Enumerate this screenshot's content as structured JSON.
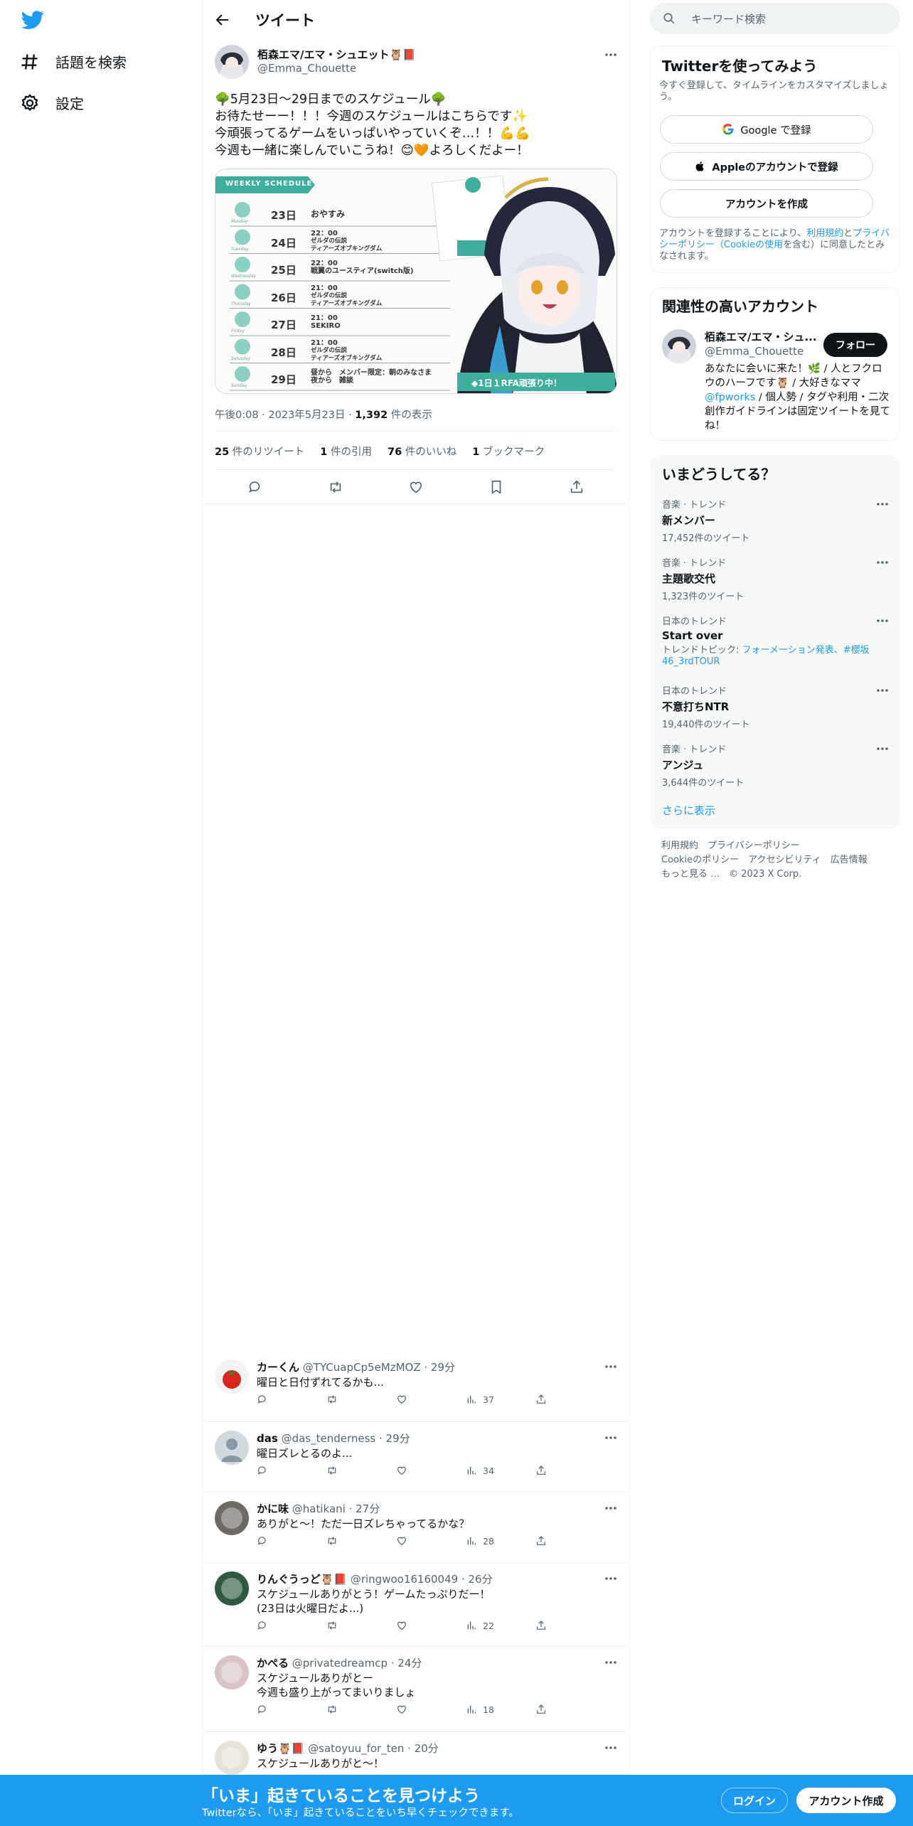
{
  "nav": {
    "explore": "話題を検索",
    "settings": "設定"
  },
  "header": {
    "title": "ツイート"
  },
  "tweet": {
    "name": "栢森エマ/エマ・シュエット🦉📕",
    "handle": "@Emma_Chouette",
    "text": "🌳5月23日～29日までのスケジュール🌳\nお待たせーー！！！今週のスケジュールはこちらです✨\n今頑張ってるゲームをいっぱいやっていくぞ…！！💪💪\n今週も一緒に楽しんでいこうね！😊🧡よろしくだよー！",
    "time": "午後0:08 · 2023年5月23日 · ",
    "views": "1,392",
    "views_label": " 件の表示",
    "retweets": "25",
    "retweets_label": " 件のリツイート",
    "quotes": "1",
    "quotes_label": " 件の引用",
    "likes": "76",
    "likes_label": " 件のいいね",
    "bookmarks": "1",
    "bookmarks_label": " ブックマーク"
  },
  "schedule": {
    "banner": "WEEKLY SCHEDULE",
    "rows": [
      {
        "day": "Monday",
        "date": "23日",
        "lines": [
          "おやすみ"
        ]
      },
      {
        "day": "Tuesday",
        "date": "24日",
        "lines": [
          "22：00",
          "ゼルダの伝説",
          "ティアーズオブキングダム"
        ]
      },
      {
        "day": "Wednesday",
        "date": "25日",
        "lines": [
          "22：00",
          "戦翼のユースティア(switch版)"
        ]
      },
      {
        "day": "Thursday",
        "date": "26日",
        "lines": [
          "21：00",
          "ゼルダの伝説",
          "ティアーズオブキングダム"
        ]
      },
      {
        "day": "Friday",
        "date": "27日",
        "lines": [
          "21：00",
          "SEKIRO"
        ]
      },
      {
        "day": "Saturday",
        "date": "28日",
        "lines": [
          "21：00",
          "ゼルダの伝説",
          "ティアーズオブキングダム"
        ]
      },
      {
        "day": "Sunday",
        "date": "29日",
        "lines": [
          "昼から　メンバー限定：朝のみなさま",
          "夜から　雑談"
        ]
      }
    ],
    "note": "◆1日１RFA頑張り中！"
  },
  "replies": [
    {
      "name": "カーくん",
      "handle": "@TYCuapCp5eMzMOZ",
      "time": " · 29分",
      "text": "曜日と日付ずれてるかも...",
      "views": "37"
    },
    {
      "name": "das",
      "handle": "@das_tenderness",
      "time": " · 29分",
      "text": "曜日ズレとるのよ...",
      "views": "34"
    },
    {
      "name": "かに味",
      "handle": "@hatikani",
      "time": " · 27分",
      "text": "ありがと～！ただ一日ズレちゃってるかな？",
      "views": "28"
    },
    {
      "name": "りんぐうっど🦉📕",
      "handle": "@ringwoo16160049",
      "time": " · 26分",
      "text": "スケジュールありがとう！ゲームたっぷりだー！\n(23日は火曜日だよ...)",
      "views": "22"
    },
    {
      "name": "かぺる",
      "handle": "@privatedreamcp",
      "time": " · 24分",
      "text": "スケジュールありがとー\n今週も盛り上がってまいりましょ",
      "views": "18"
    },
    {
      "name": "ゆう🦉📕",
      "handle": "@satoyuu_for_ten",
      "time": " · 20分",
      "text": "スケジュールありがと～！",
      "views": ""
    }
  ],
  "right": {
    "search_placeholder": "キーワード検索",
    "signup": {
      "title": "Twitterを使ってみよう",
      "subtitle": "今すぐ登録して、タイムラインをカスタマイズしましょう。",
      "google": "Google で登録",
      "apple": "Appleのアカウントで登録",
      "create": "アカウントを作成",
      "legal_1": "アカウントを登録することにより、",
      "legal_terms": "利用規約",
      "legal_2": "と",
      "legal_privacy": "プライバシーポリシー（Cookieの使用",
      "legal_3": "を含む）に同意したとみなされます。"
    },
    "related": {
      "title": "関連性の高いアカウント",
      "name": "栢森エマ/エマ・シュ...",
      "handle": "@Emma_Chouette",
      "follow": "フォロー",
      "bio_1": "あなたに会いに来た！🌿 / 人とフクロウのハーフです🦉 / 大好きなママ",
      "bio_link": "@fpworks",
      "bio_2": " / 個人勢 / タグや利用・二次創作ガイドラインは固定ツイートを見てね！"
    },
    "trends": {
      "title": "いまどうしてる？",
      "items": [
        {
          "cat": "音楽 · トレンド",
          "name": "新メンバー",
          "count": "17,452件のツイート"
        },
        {
          "cat": "音楽 · トレンド",
          "name": "主題歌交代",
          "count": "1,323件のツイート"
        },
        {
          "cat": "日本のトレンド",
          "name": "Start over",
          "topic_label": "トレンドトピック: ",
          "topic": "フォーメーション発表、#櫻坂46_3rdTOUR"
        },
        {
          "cat": "日本のトレンド",
          "name": "不意打ちNTR",
          "count": "19,440件のツイート"
        },
        {
          "cat": "音楽 · トレンド",
          "name": "アンジュ",
          "count": "3,644件のツイート"
        }
      ],
      "show_more": "さらに表示"
    },
    "footer": {
      "line1": "利用規約　プライバシーポリシー",
      "line2": "Cookieのポリシー　アクセシビリティ　広告情報",
      "line3": "もっと見る …　© 2023 X Corp."
    }
  },
  "banner": {
    "title": "「いま」起きていることを見つけよう",
    "subtitle": "Twitterなら、「いま」起きていることをいち早くチェックできます。",
    "login": "ログイン",
    "signup": "アカウント作成"
  },
  "colors": {
    "accent": "#1d9bf0",
    "text": "#0f1419",
    "muted": "#536471",
    "schedule_green": "#3fae9d"
  }
}
